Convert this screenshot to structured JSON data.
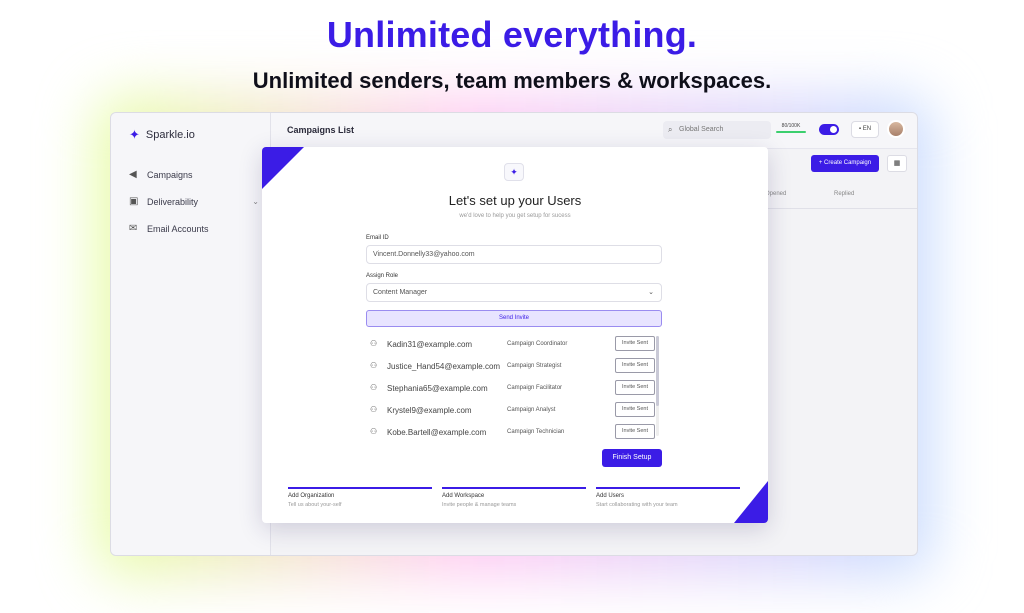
{
  "hero": {
    "headline": "Unlimited everything.",
    "subheadline": "Unlimited senders, team members & workspaces."
  },
  "app": {
    "logo": "Sparkle.io",
    "sidebar": {
      "items": [
        {
          "label": "Campaigns",
          "icon": "megaphone-icon"
        },
        {
          "label": "Deliverability",
          "icon": "inbox-check-icon"
        },
        {
          "label": "Email Accounts",
          "icon": "mail-icon"
        }
      ]
    },
    "topbar": {
      "title": "Campaigns List",
      "search_placeholder": "Global Search",
      "usage": "80/100K",
      "language": "EN"
    },
    "toolbar": {
      "create_label": "+ Create Campaign"
    },
    "table": {
      "headers": [
        "Opened",
        "Replied"
      ]
    }
  },
  "modal": {
    "title": "Let's set up your Users",
    "subtitle": "we'd love to help you get setup for sucess",
    "email_label": "Email ID",
    "email_value": "Vincent.Donnelly33@yahoo.com",
    "role_label": "Assign Role",
    "role_value": "Content Manager",
    "send_label": "Send Invite",
    "users": [
      {
        "email": "Kadin31@example.com",
        "role": "Campaign Coordinator",
        "status": "Invite Sent"
      },
      {
        "email": "Justice_Hand54@example.com",
        "role": "Campaign Strategist",
        "status": "Invite Sent"
      },
      {
        "email": "Stephania65@example.com",
        "role": "Campaign Facilitator",
        "status": "Invite Sent"
      },
      {
        "email": "Krystel9@example.com",
        "role": "Campaign Analyst",
        "status": "Invite Sent"
      },
      {
        "email": "Kobe.Bartell@example.com",
        "role": "Campaign Technician",
        "status": "Invite Sent"
      }
    ],
    "finish_label": "Finish Setup",
    "steps": [
      {
        "title": "Add Organization",
        "desc": "Tell us about your-self"
      },
      {
        "title": "Add Workspace",
        "desc": "Invite people & manage teams"
      },
      {
        "title": "Add Users",
        "desc": "Start collaborating with your team"
      }
    ]
  },
  "colors": {
    "accent": "#3b1ce6",
    "usage_bar": "#3ccf6e"
  }
}
